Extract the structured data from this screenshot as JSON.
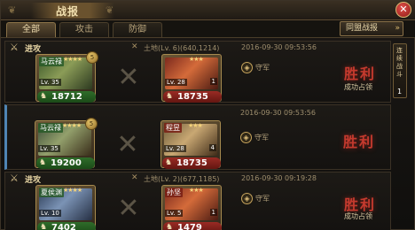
{
  "window": {
    "title": "战报",
    "close_label": "✕"
  },
  "tabs": [
    {
      "label": "全部",
      "active": true
    },
    {
      "label": "攻击",
      "active": false
    },
    {
      "label": "防御",
      "active": false
    }
  ],
  "alliance_button": {
    "label": "同盟战报",
    "arrow": "»"
  },
  "side_panel": {
    "label": "连续战斗",
    "count": "1"
  },
  "reports": [
    {
      "type": "进攻",
      "location": "土地(Lv. 6)(640,1214)",
      "time": "2016-09-30 09:53:56",
      "attacker": {
        "name": "马云禄",
        "level": "Lv. 35",
        "stars": "★★★★",
        "badge": "5",
        "troops": "18712"
      },
      "defender": {
        "name": "",
        "level": "Lv. 28",
        "stars": "★★★",
        "badge": "",
        "count": "1",
        "troops": "18735"
      },
      "role": "守军",
      "result": "胜利",
      "result_sub": "成功占领"
    },
    {
      "type": "",
      "location": "",
      "time": "2016-09-30 09:53:56",
      "attacker": {
        "name": "马云禄",
        "level": "Lv. 35",
        "stars": "★★★★",
        "badge": "5",
        "troops": "19200"
      },
      "defender": {
        "name": "程昱",
        "level": "Lv. 28",
        "stars": "★★★",
        "badge": "",
        "count": "4",
        "troops": "18735"
      },
      "role": "守军",
      "result": "胜利",
      "result_sub": ""
    },
    {
      "type": "进攻",
      "location": "土地(Lv. 2)(677,1185)",
      "time": "2016-09-30 09:19:28",
      "attacker": {
        "name": "夏侯渊",
        "level": "Lv. 10",
        "stars": "★★★★",
        "badge": "",
        "troops": "7402"
      },
      "defender": {
        "name": "孙坚",
        "level": "Lv. 5",
        "stars": "★★★",
        "badge": "",
        "count": "1",
        "troops": "1479"
      },
      "role": "守军",
      "result": "胜利",
      "result_sub": "成功占领"
    }
  ],
  "icons": {
    "close": "close-icon",
    "attack_type": "crossed-swords-icon",
    "location": "crossed-swords-small-icon",
    "role": "shield-role-icon",
    "troops": "soldier-icon",
    "vs": "crossed-blades-icon"
  },
  "colors": {
    "win": "#c43a2e",
    "attacker_troops": "#2f6d2a",
    "defender_troops": "#9a2b24",
    "selected_accent": "#4f85b4"
  }
}
